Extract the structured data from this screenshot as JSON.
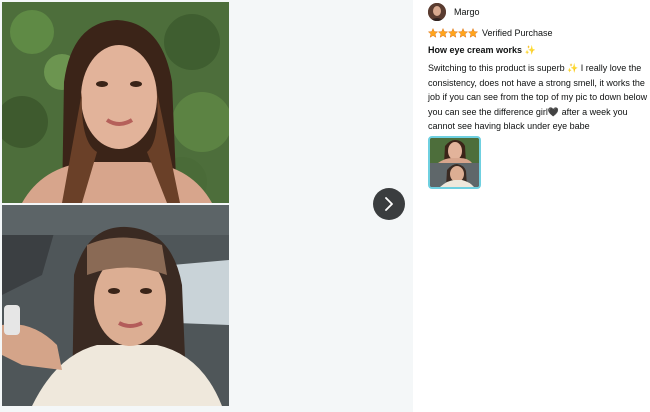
{
  "viewer": {
    "photo_top_icon": "photo-icon",
    "photo_bottom_icon": "photo-icon",
    "next_icon": "chevron-right-icon"
  },
  "review": {
    "reviewer_name": "Margo",
    "rating": 5,
    "rating_max": 5,
    "star_color": "#ffa41c",
    "verified_label": "Verified Purchase",
    "title": "How eye cream works ✨",
    "body": "Switching to this product is superb ✨ I really love the consistency, does not have a strong smell, it works the job if you can see from the top of my pic to down below you can see the difference girl🖤 after a week you cannot see having black under eye babe"
  },
  "thumbnail": {
    "border_color": "#6fd0e0"
  }
}
